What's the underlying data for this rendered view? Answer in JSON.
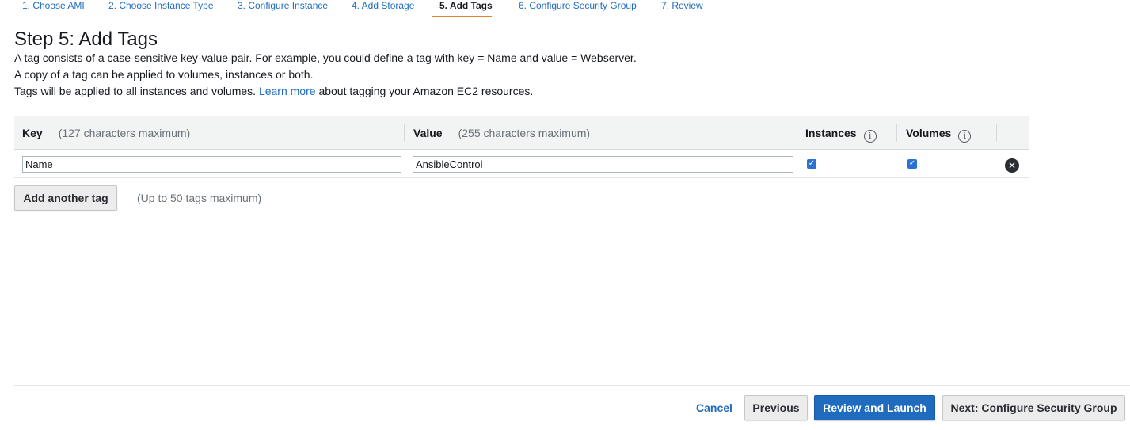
{
  "wizard": {
    "tabs": [
      {
        "label": "1. Choose AMI"
      },
      {
        "label": "2. Choose Instance Type"
      },
      {
        "label": "3. Configure Instance"
      },
      {
        "label": "4. Add Storage"
      },
      {
        "label": "5. Add Tags",
        "active": true
      },
      {
        "label": "6. Configure Security Group"
      },
      {
        "label": "7. Review"
      }
    ]
  },
  "page": {
    "title": "Step 5: Add Tags",
    "line1": "A tag consists of a case-sensitive key-value pair. For example, you could define a tag with key = Name and value = Webserver.",
    "line2": "A copy of a tag can be applied to volumes, instances or both.",
    "line3_before": "Tags will be applied to all instances and volumes.",
    "learn_more": "Learn more",
    "line3_after": "about tagging your Amazon EC2 resources."
  },
  "table": {
    "headers": {
      "key": "Key",
      "key_hint": "(127 characters maximum)",
      "value": "Value",
      "value_hint": "(255 characters maximum)",
      "instances": "Instances",
      "volumes": "Volumes"
    },
    "rows": [
      {
        "key": "Name",
        "value": "AnsibleControl",
        "instances": true,
        "volumes": true
      }
    ]
  },
  "add_tag": {
    "button": "Add another tag",
    "hint": "(Up to 50 tags maximum)"
  },
  "footer": {
    "cancel": "Cancel",
    "previous": "Previous",
    "review_launch": "Review and Launch",
    "next": "Next: Configure Security Group"
  },
  "colors": {
    "link": "#1f6cbf",
    "active_tab_underline": "#e8822a",
    "primary_button": "#1f6cbf",
    "checkbox": "#2b72d6"
  },
  "icons": [
    "info-icon",
    "check-icon",
    "remove-icon"
  ]
}
